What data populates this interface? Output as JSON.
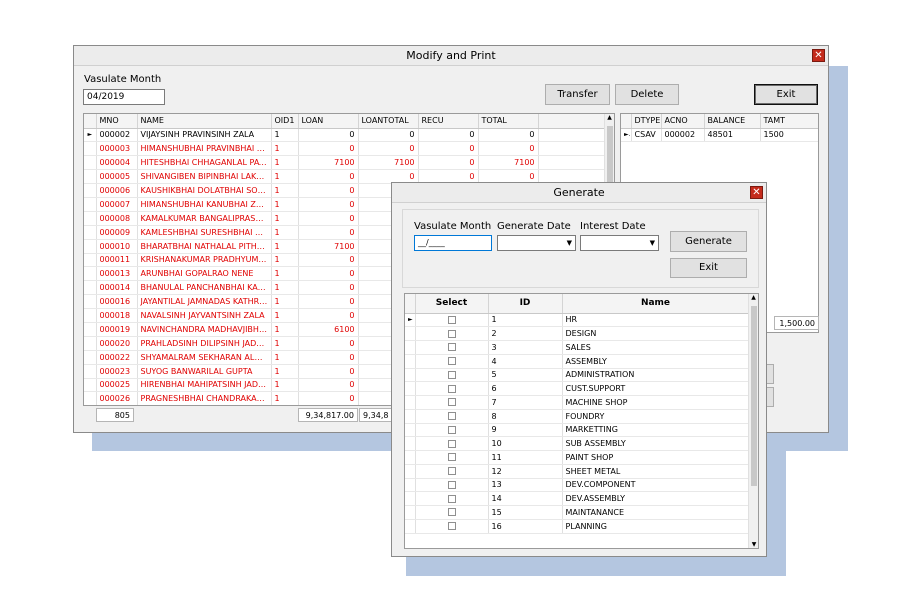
{
  "main": {
    "title": "Modify and Print",
    "month_label": "Vasulate Month",
    "month_value": "04/2019",
    "buttons": {
      "transfer": "Transfer",
      "delete": "Delete",
      "exit": "Exit"
    },
    "columns": [
      "MNO",
      "NAME",
      "OID1",
      "LOAN",
      "LOANTOTAL",
      "RECU",
      "TOTAL"
    ],
    "rows": [
      {
        "mno": "000002",
        "name": "VIJAYSINH PRAVINSINH ZALA",
        "oid": "1",
        "loan": "0",
        "loantotal": "0",
        "recu": "0",
        "total": "0",
        "color": "black"
      },
      {
        "mno": "000003",
        "name": "HIMANSHUBHAI PRAVINBHAI SHA...",
        "oid": "1",
        "loan": "0",
        "loantotal": "0",
        "recu": "0",
        "total": "0",
        "color": "red"
      },
      {
        "mno": "000004",
        "name": "HITESHBHAI CHHAGANLAL PATEL",
        "oid": "1",
        "loan": "7100",
        "loantotal": "7100",
        "recu": "0",
        "total": "7100",
        "color": "red"
      },
      {
        "mno": "000005",
        "name": "SHIVANGIBEN BIPINBHAI LAKHANI",
        "oid": "1",
        "loan": "0",
        "loantotal": "0",
        "recu": "0",
        "total": "0",
        "color": "red"
      },
      {
        "mno": "000006",
        "name": "KAUSHIKBHAI DOLATBHAI SOLANKI",
        "oid": "1",
        "loan": "0",
        "loantotal": "",
        "recu": "",
        "total": "",
        "color": "red"
      },
      {
        "mno": "000007",
        "name": "HIMANSHUBHAI KANUBHAI ZALA",
        "oid": "1",
        "loan": "0",
        "loantotal": "",
        "recu": "",
        "total": "",
        "color": "red"
      },
      {
        "mno": "000008",
        "name": "KAMALKUMAR BANGALIPRASAD M...",
        "oid": "1",
        "loan": "0",
        "loantotal": "",
        "recu": "",
        "total": "",
        "color": "red"
      },
      {
        "mno": "000009",
        "name": "KAMLESHBHAI SURESHBHAI SOLAN...",
        "oid": "1",
        "loan": "0",
        "loantotal": "",
        "recu": "",
        "total": "",
        "color": "red"
      },
      {
        "mno": "000010",
        "name": "BHARATBHAI  NATHALAL PITHADIYA",
        "oid": "1",
        "loan": "7100",
        "loantotal": "",
        "recu": "",
        "total": "",
        "color": "red"
      },
      {
        "mno": "000011",
        "name": "KRISHANAKUMAR PRADHYUMANSI...",
        "oid": "1",
        "loan": "0",
        "loantotal": "",
        "recu": "",
        "total": "",
        "color": "red"
      },
      {
        "mno": "000013",
        "name": "ARUNBHAI GOPALRAO NENE",
        "oid": "1",
        "loan": "0",
        "loantotal": "",
        "recu": "",
        "total": "",
        "color": "red"
      },
      {
        "mno": "000014",
        "name": "BHANULAL PANCHANBHAI KACHA",
        "oid": "1",
        "loan": "0",
        "loantotal": "",
        "recu": "",
        "total": "",
        "color": "red"
      },
      {
        "mno": "000016",
        "name": "JAYANTILAL JAMNADAS KATHROTIYA",
        "oid": "1",
        "loan": "0",
        "loantotal": "",
        "recu": "",
        "total": "",
        "color": "red"
      },
      {
        "mno": "000018",
        "name": "NAVALSINH JAYVANTSINH ZALA",
        "oid": "1",
        "loan": "0",
        "loantotal": "",
        "recu": "",
        "total": "",
        "color": "red"
      },
      {
        "mno": "000019",
        "name": "NAVINCHANDRA MADHAVJIBHAI N...",
        "oid": "1",
        "loan": "6100",
        "loantotal": "",
        "recu": "",
        "total": "",
        "color": "red"
      },
      {
        "mno": "000020",
        "name": "PRAHLADSINH DILIPSINH JADEJA",
        "oid": "1",
        "loan": "0",
        "loantotal": "",
        "recu": "",
        "total": "",
        "color": "red"
      },
      {
        "mno": "000022",
        "name": "SHYAMALRAM SEKHARAN ALAKKAD...",
        "oid": "1",
        "loan": "0",
        "loantotal": "",
        "recu": "",
        "total": "",
        "color": "red"
      },
      {
        "mno": "000023",
        "name": "SUYOG BANWARILAL GUPTA",
        "oid": "1",
        "loan": "0",
        "loantotal": "",
        "recu": "",
        "total": "",
        "color": "red"
      },
      {
        "mno": "000025",
        "name": "HIRENBHAI MAHIPATSINH JADEJA",
        "oid": "1",
        "loan": "0",
        "loantotal": "",
        "recu": "",
        "total": "",
        "color": "red"
      },
      {
        "mno": "000026",
        "name": "PRAGNESHBHAI CHANDRAKANTBH...",
        "oid": "1",
        "loan": "0",
        "loantotal": "",
        "recu": "",
        "total": "",
        "color": "red"
      }
    ],
    "footer": {
      "count": "805",
      "loan_total": "9,34,817.00",
      "loantotal_total": "9,34,8"
    },
    "right_columns": [
      "DTYPE",
      "ACNO",
      "BALANCE",
      "TAMT"
    ],
    "right_rows": [
      {
        "dtype": "CSAV",
        "acno": "000002",
        "balance": "48501",
        "tamt": "1500"
      }
    ],
    "right_total": "1,500.00"
  },
  "dialog": {
    "title": "Generate",
    "month_label": "Vasulate Month",
    "month_placeholder": "__/____",
    "gen_date_label": "Generate Date",
    "int_date_label": "Interest Date",
    "generate_btn": "Generate",
    "exit_btn": "Exit",
    "columns": [
      "Select",
      "ID",
      "Name"
    ],
    "rows": [
      {
        "id": "1",
        "name": "HR"
      },
      {
        "id": "2",
        "name": "DESIGN"
      },
      {
        "id": "3",
        "name": "SALES"
      },
      {
        "id": "4",
        "name": "ASSEMBLY"
      },
      {
        "id": "5",
        "name": "ADMINISTRATION"
      },
      {
        "id": "6",
        "name": "CUST.SUPPORT"
      },
      {
        "id": "7",
        "name": "MACHINE SHOP"
      },
      {
        "id": "8",
        "name": "FOUNDRY"
      },
      {
        "id": "9",
        "name": "MARKETTING"
      },
      {
        "id": "10",
        "name": "SUB ASSEMBLY"
      },
      {
        "id": "11",
        "name": "PAINT SHOP"
      },
      {
        "id": "12",
        "name": "SHEET METAL"
      },
      {
        "id": "13",
        "name": "DEV.COMPONENT"
      },
      {
        "id": "14",
        "name": "DEV.ASSEMBLY"
      },
      {
        "id": "15",
        "name": "MAINTANANCE"
      },
      {
        "id": "16",
        "name": "PLANNING"
      }
    ]
  }
}
